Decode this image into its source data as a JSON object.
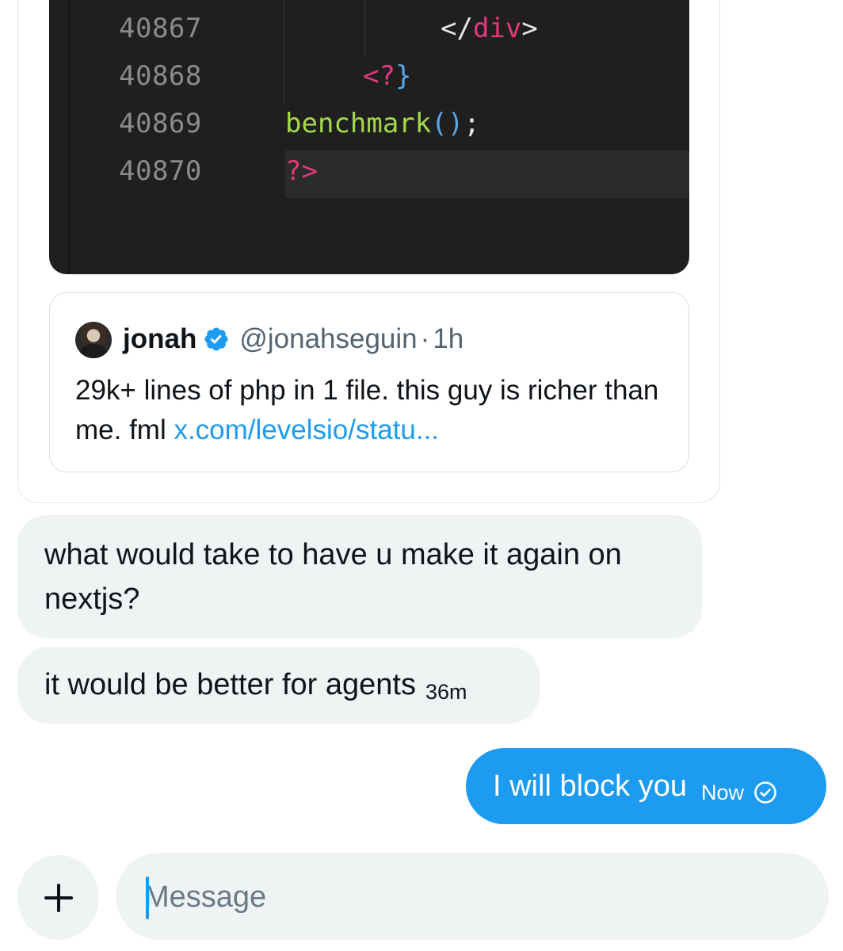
{
  "shared_tweet": {
    "code_image": {
      "lines": [
        {
          "number": "40867",
          "code": "</div>"
        },
        {
          "number": "40868",
          "code": "<?}"
        },
        {
          "number": "40869",
          "code": "benchmark();"
        },
        {
          "number": "40870",
          "code": "?>"
        }
      ]
    },
    "quote": {
      "name": "jonah",
      "handle": "@jonahseguin",
      "separator": "·",
      "time": "1h",
      "text": "29k+ lines of php in 1 file. this guy is richer than me. fml ",
      "link": "x.com/levelsio/statu..."
    }
  },
  "messages": [
    {
      "text": "what would take to have u make it again on nextjs?"
    },
    {
      "text": "it would be better for agents",
      "time": "36m"
    },
    {
      "text": "I will block you",
      "time": "Now",
      "status_icon": "sent-check-icon"
    }
  ],
  "composer": {
    "add_icon": "plus-icon",
    "placeholder": "Message"
  },
  "colors": {
    "accent": "#1d9bf0",
    "bubble_gray": "#eff3f4",
    "code_bg": "#1f1f1f",
    "code_tag": "#e3387a",
    "code_function": "#a6d94a",
    "code_paren": "#5aa7ea"
  }
}
